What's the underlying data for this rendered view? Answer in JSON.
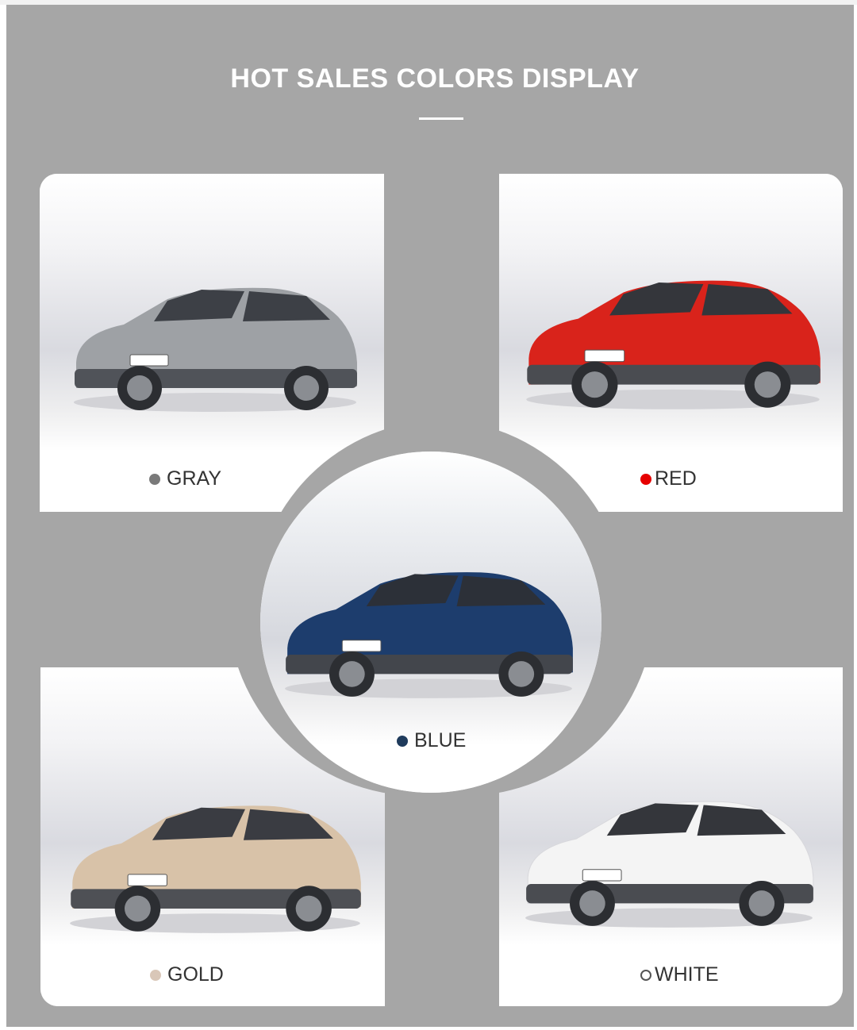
{
  "header": {
    "title": "HOT SALES COLORS DISPLAY"
  },
  "colors": {
    "gray": {
      "label": "GRAY",
      "dot": "#7a7a7a",
      "body": "#9ea1a5"
    },
    "red": {
      "label": "RED",
      "dot": "#e60000",
      "body": "#d9231b"
    },
    "blue": {
      "label": "BLUE",
      "dot": "#1f3b5c",
      "body": "#1d3d6d"
    },
    "gold": {
      "label": "GOLD",
      "dot": "#d9c7b8",
      "body": "#d8c2a8"
    },
    "white": {
      "label": "WHITE",
      "dot": "#ffffff",
      "body": "#f4f4f4"
    }
  },
  "icons": {
    "car": "car-icon",
    "swatch": "color-dot-icon"
  }
}
